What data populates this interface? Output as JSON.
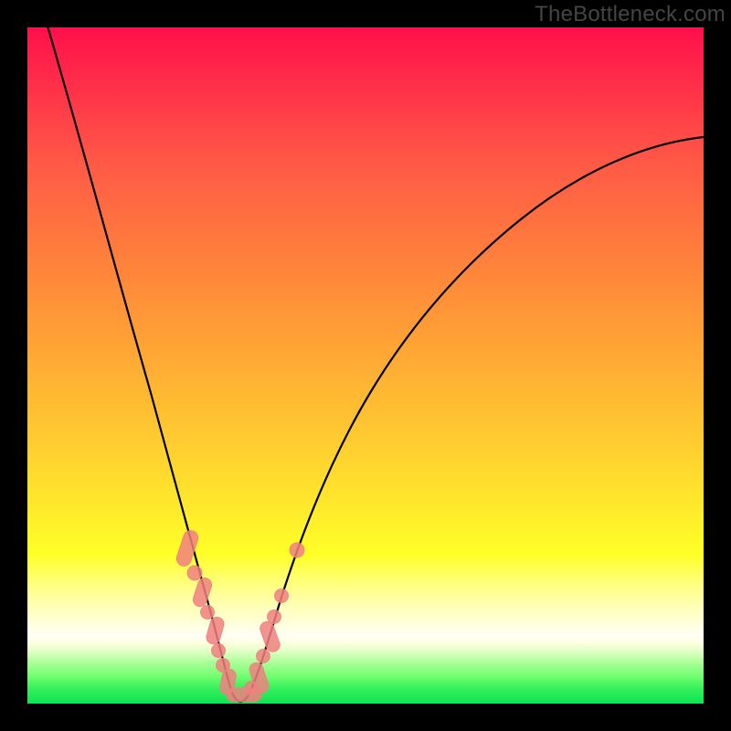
{
  "watermark": "TheBottleneck.com",
  "chart_data": {
    "type": "line",
    "title": "",
    "xlabel": "",
    "ylabel": "",
    "xlim": [
      0,
      100
    ],
    "ylim": [
      0,
      100
    ],
    "grid": false,
    "series": [
      {
        "name": "curve",
        "type": "line",
        "color": "#000000",
        "x": [
          2,
          5,
          8,
          11,
          14,
          17,
          20,
          23,
          25,
          27,
          28.5,
          30,
          32,
          34,
          36,
          38,
          41,
          45,
          50,
          56,
          63,
          71,
          80,
          90,
          98
        ],
        "values": [
          -2,
          15,
          30,
          42,
          53,
          62,
          70,
          77,
          83,
          89,
          94,
          99,
          99,
          97,
          93,
          88,
          82,
          72,
          62,
          52,
          43,
          35,
          28,
          22,
          18
        ]
      },
      {
        "name": "markers",
        "type": "scatter",
        "color": "#f08080",
        "x": [
          23.5,
          24.5,
          25.2,
          26.5,
          27.0,
          27.8,
          28.3,
          29.0,
          29.5,
          30.5,
          31.5,
          32.5,
          33.5,
          34.8,
          35.8,
          37.0,
          38.5
        ],
        "values": [
          79,
          82,
          84,
          88,
          90,
          93,
          95,
          97,
          99,
          99,
          99,
          98,
          96,
          93,
          90,
          86,
          76
        ]
      }
    ],
    "background_gradient": {
      "top_color": "#ff0f4a",
      "mid_color": "#ffe02c",
      "bottom_color": "#0ee452"
    }
  }
}
